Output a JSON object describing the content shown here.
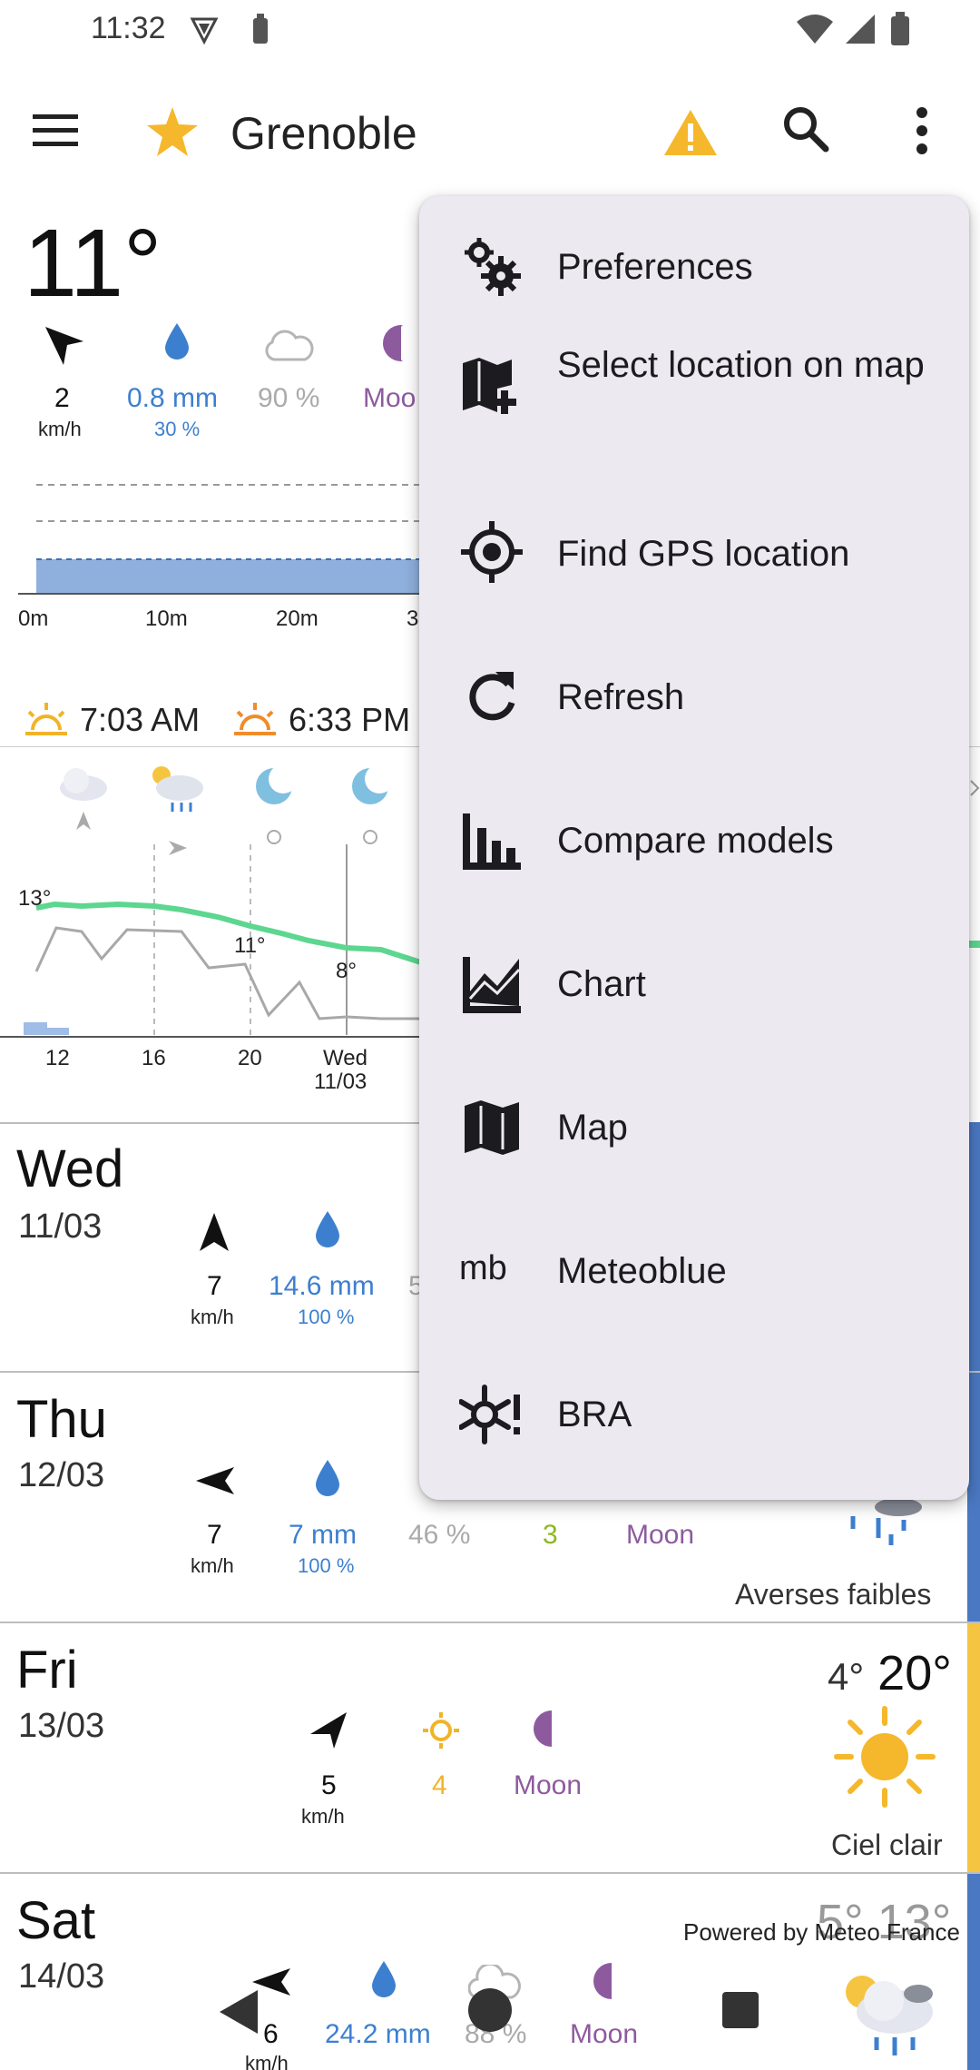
{
  "status_bar": {
    "time": "11:32"
  },
  "app_bar": {
    "title": "Grenoble"
  },
  "current": {
    "temperature": "11°",
    "wind_speed": "2",
    "wind_unit": "km/h",
    "precip": "0.8 mm",
    "precip_prob": "30 %",
    "cloud": "90 %",
    "moon": "Moo",
    "axis_labels": [
      "0m",
      "10m",
      "20m",
      "3"
    ],
    "sunrise": "7:03 AM",
    "sunset": "6:33 PM"
  },
  "hourly": {
    "temp_labels": [
      "13°",
      "11°",
      "8°"
    ],
    "hour_labels": [
      "12",
      "16",
      "20",
      "Wed",
      "11/03"
    ]
  },
  "days": [
    {
      "name": "Wed",
      "date": "11/03",
      "wind": "7",
      "wind_unit": "km/h",
      "precip": "14.6 mm",
      "precip_prob": "100 %",
      "cloud": "5"
    },
    {
      "name": "Thu",
      "date": "12/03",
      "wind": "7",
      "wind_unit": "km/h",
      "precip": "7 mm",
      "precip_prob": "100 %",
      "cloud": "46 %",
      "uv": "3",
      "moon": "Moon",
      "desc": "Averses faibles"
    },
    {
      "name": "Fri",
      "date": "13/03",
      "wind": "5",
      "wind_unit": "km/h",
      "uv": "4",
      "moon": "Moon",
      "temp_low": "4°",
      "temp_high": "20°",
      "desc": "Ciel clair"
    },
    {
      "name": "Sat",
      "date": "14/03",
      "wind": "6",
      "wind_unit": "km/h",
      "precip": "24.2 mm",
      "cloud": "88 %",
      "moon": "Moon",
      "temp_partial": "5° 13°"
    }
  ],
  "powered_by": "Powered by Meteo France",
  "menu": {
    "items": [
      {
        "label": "Preferences",
        "icon": "settings-gears-icon"
      },
      {
        "label": "Select location on map",
        "icon": "map-add-icon"
      },
      {
        "label": "Find GPS location",
        "icon": "gps-crosshair-icon"
      },
      {
        "label": "Refresh",
        "icon": "refresh-icon"
      },
      {
        "label": "Compare models",
        "icon": "bar-chart-icon"
      },
      {
        "label": "Chart",
        "icon": "area-chart-icon"
      },
      {
        "label": "Map",
        "icon": "map-icon"
      },
      {
        "label": "Meteoblue",
        "icon": "mb"
      },
      {
        "label": "BRA",
        "icon": "snowflake-alert-icon"
      }
    ]
  },
  "colors": {
    "accent_star": "#f5b72b",
    "warning": "#f5b72b",
    "precip_blue": "#3d7fcf",
    "moon_purple": "#8e5a9e",
    "uv_yellow": "#f0b429",
    "temp_line_green": "#5dd690"
  }
}
